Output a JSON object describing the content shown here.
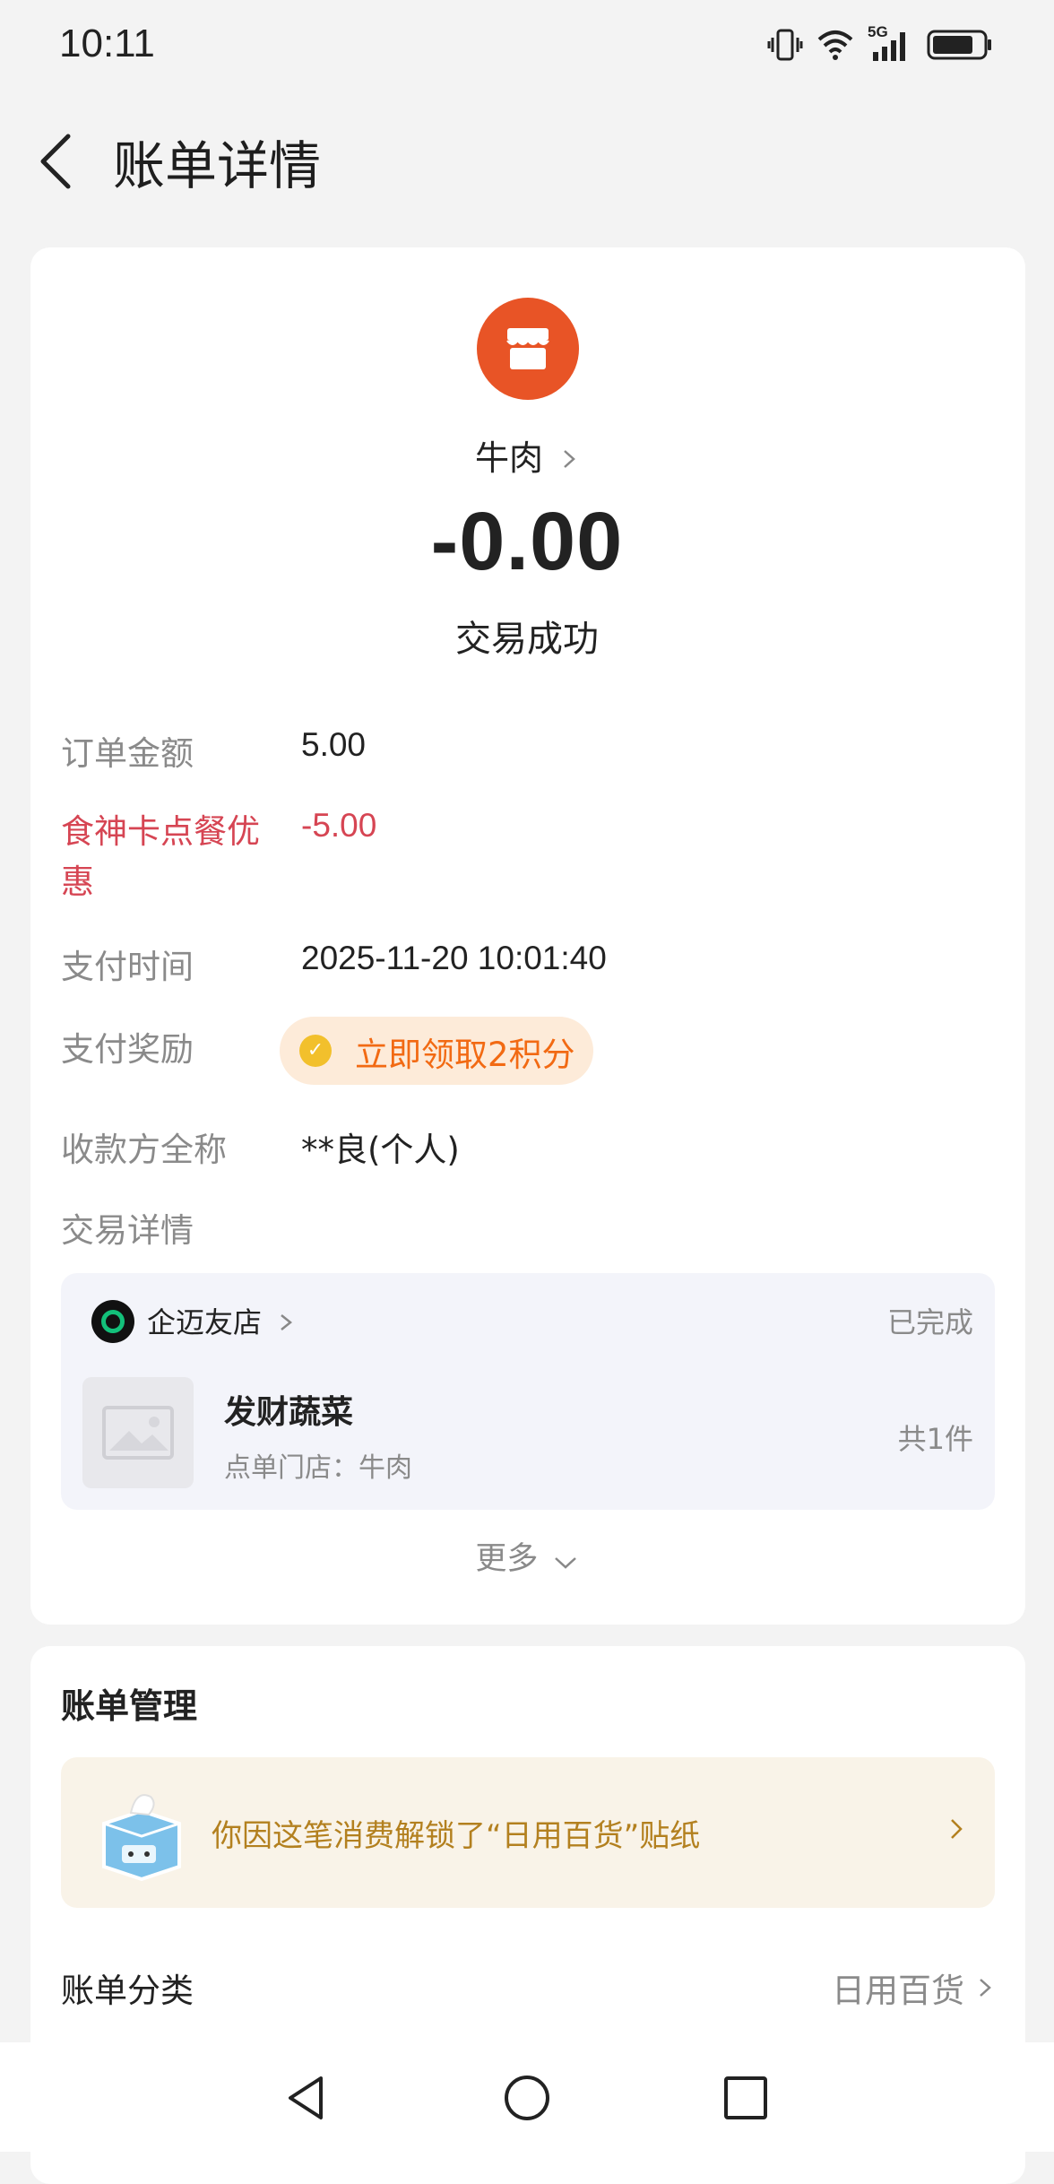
{
  "status_bar": {
    "time": "10:11",
    "network_label": "5G",
    "icons": [
      "vibrate-icon",
      "wifi-icon",
      "signal-icon",
      "battery-icon"
    ]
  },
  "header": {
    "title": "账单详情",
    "back_icon": "chevron-left-icon"
  },
  "merchant": {
    "name": "牛肉",
    "avatar_icon": "storefront-icon",
    "avatar_color": "#e85426"
  },
  "amount": "-0.00",
  "transaction_status": "交易成功",
  "details": [
    {
      "label": "订单金额",
      "value": "5.00",
      "highlight": false
    },
    {
      "label": "食神卡点餐优惠",
      "value": "-5.00",
      "highlight": true
    },
    {
      "label": "支付时间",
      "value": "2025-11-20 10:01:40",
      "highlight": false
    },
    {
      "label": "支付奖励",
      "value": "立即领取2积分",
      "highlight": false
    },
    {
      "label": "收款方全称",
      "value": "**良(个人)",
      "highlight": false
    },
    {
      "label": "交易详情",
      "value": "",
      "highlight": false
    }
  ],
  "order": {
    "shop_name": "企迈友店",
    "status": "已完成",
    "product_name": "发财蔬菜",
    "product_store": "点单门店：牛肉",
    "count": "共1件"
  },
  "more_label": "更多",
  "manage": {
    "title": "账单管理",
    "sticker_text": "你因这笔消费解锁了“日用百货”贴纸",
    "category_label": "账单分类",
    "category_value": "日用百货"
  },
  "colors": {
    "accent_red": "#d64553",
    "reward_orange": "#f26a13",
    "sticker_gold": "#b3801f"
  }
}
